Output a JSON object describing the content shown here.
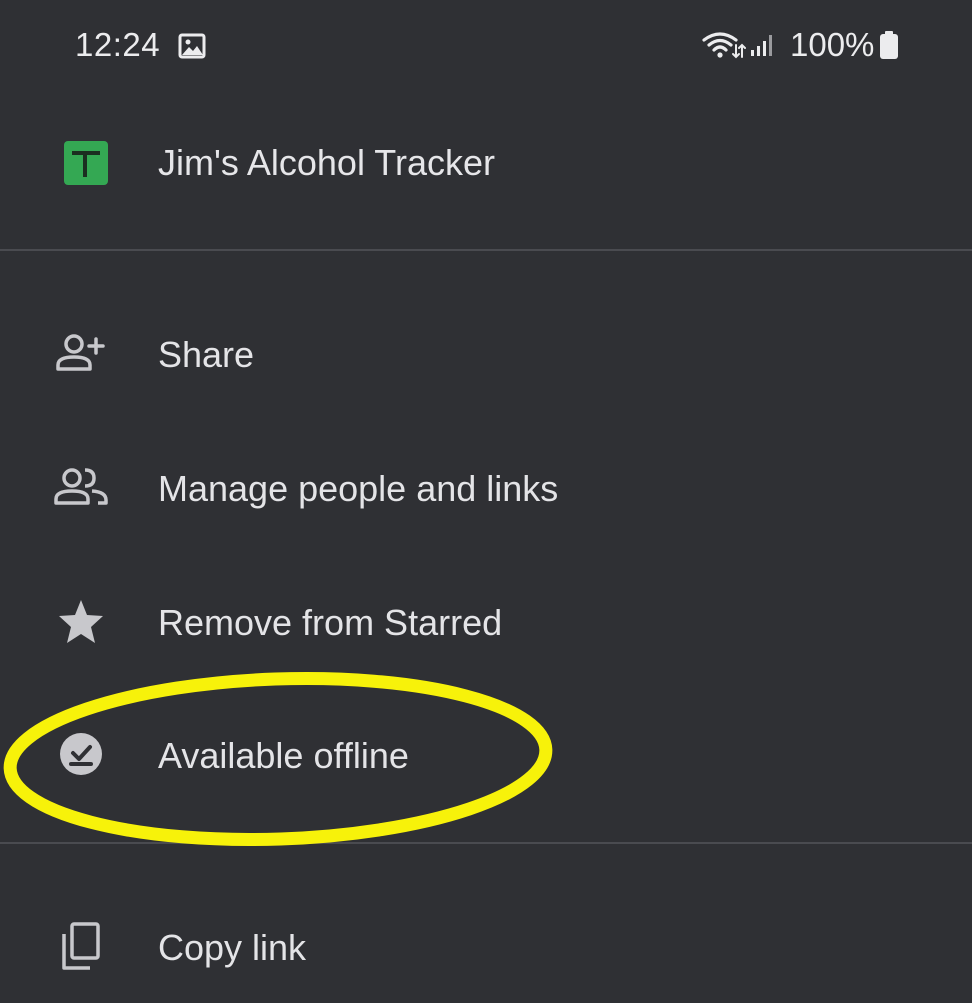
{
  "status_bar": {
    "time": "12:24",
    "battery": "100%"
  },
  "file": {
    "title": "Jim's Alcohol Tracker",
    "icon": "google-sheets-icon",
    "icon_color": "#34a853"
  },
  "menu": {
    "items": [
      {
        "label": "Share",
        "icon": "person-add-icon"
      },
      {
        "label": "Manage people and links",
        "icon": "people-icon"
      },
      {
        "label": "Remove from Starred",
        "icon": "star-icon"
      },
      {
        "label": "Available offline",
        "icon": "offline-check-icon"
      },
      {
        "label": "Copy link",
        "icon": "copy-icon"
      }
    ]
  },
  "colors": {
    "background": "#2f3034",
    "text": "#e4e4e7",
    "icon": "#c8c8cc",
    "divider": "#4a4b50",
    "highlight": "#f7f20a"
  }
}
